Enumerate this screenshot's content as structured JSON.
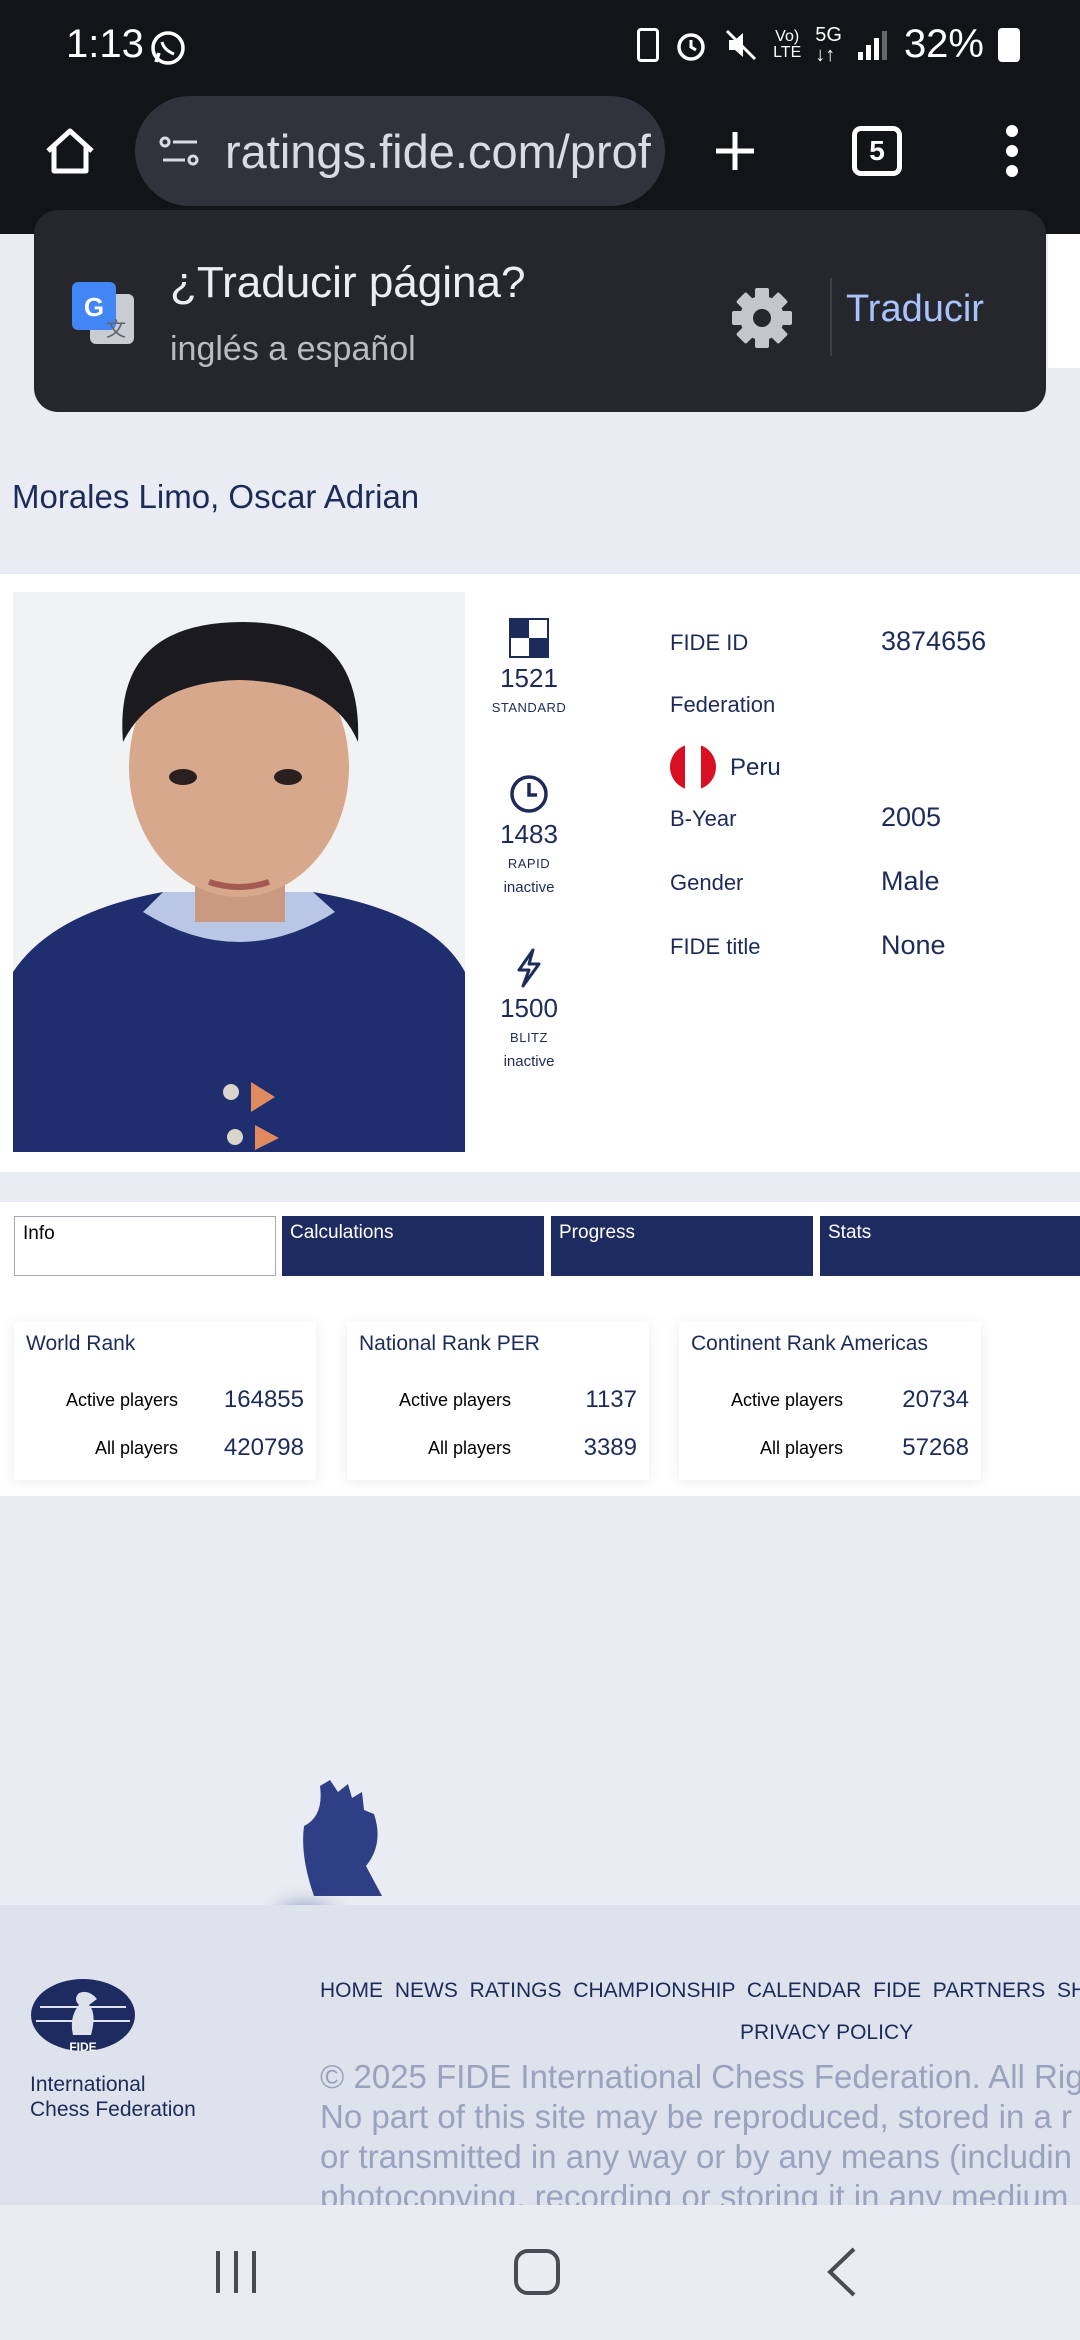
{
  "status_bar": {
    "time": "1:13",
    "battery": "32%"
  },
  "browser": {
    "url": "ratings.fide.com/prof",
    "tab_count": "5"
  },
  "translate_bar": {
    "title": "¿Traducir página?",
    "subtitle": "inglés a español",
    "translate_label": "Traducir"
  },
  "player": {
    "name": "Morales Limo, Oscar Adrian"
  },
  "ratings": [
    {
      "value": "1521",
      "label": "STANDARD",
      "status": ""
    },
    {
      "value": "1483",
      "label": "RAPID",
      "status": "inactive"
    },
    {
      "value": "1500",
      "label": "BLITZ",
      "status": "inactive"
    }
  ],
  "profile": {
    "fide_id_label": "FIDE ID",
    "fide_id_value": "3874656",
    "federation_label": "Federation",
    "federation_value": "Peru",
    "byear_label": "B-Year",
    "byear_value": "2005",
    "gender_label": "Gender",
    "gender_value": "Male",
    "title_label": "FIDE title",
    "title_value": "None"
  },
  "tabs": [
    "Info",
    "Calculations",
    "Progress",
    "Stats"
  ],
  "ranks": [
    {
      "title": "World Rank",
      "active_label": "Active players",
      "active_value": "164855",
      "all_label": "All players",
      "all_value": "420798"
    },
    {
      "title": "National Rank PER",
      "active_label": "Active players",
      "active_value": "1137",
      "all_label": "All players",
      "all_value": "3389"
    },
    {
      "title": "Continent Rank Americas",
      "active_label": "Active players",
      "active_value": "20734",
      "all_label": "All players",
      "all_value": "57268"
    }
  ],
  "footer": {
    "nav": "HOME NEWS RATINGS CHAMPIONSHIP CALENDAR FIDE PARTNERS SHO",
    "privacy": "PRIVACY POLICY",
    "copy_1": "© 2025 FIDE International Chess Federation. All Rig",
    "copy_2": "No part of this site may be reproduced, stored in a r",
    "copy_3": "or transmitted in any way or by any means (includin",
    "copy_4": "photocopying, recording or storing it in any medium",
    "org_line1": "International",
    "org_line2": "Chess Federation",
    "logo_text": "FIDE"
  },
  "colors": {
    "navy": "#1d2b5b",
    "tab_navy": "#1e2b60",
    "browser_dark": "#131417",
    "translate_blue": "#a9c3ff"
  }
}
